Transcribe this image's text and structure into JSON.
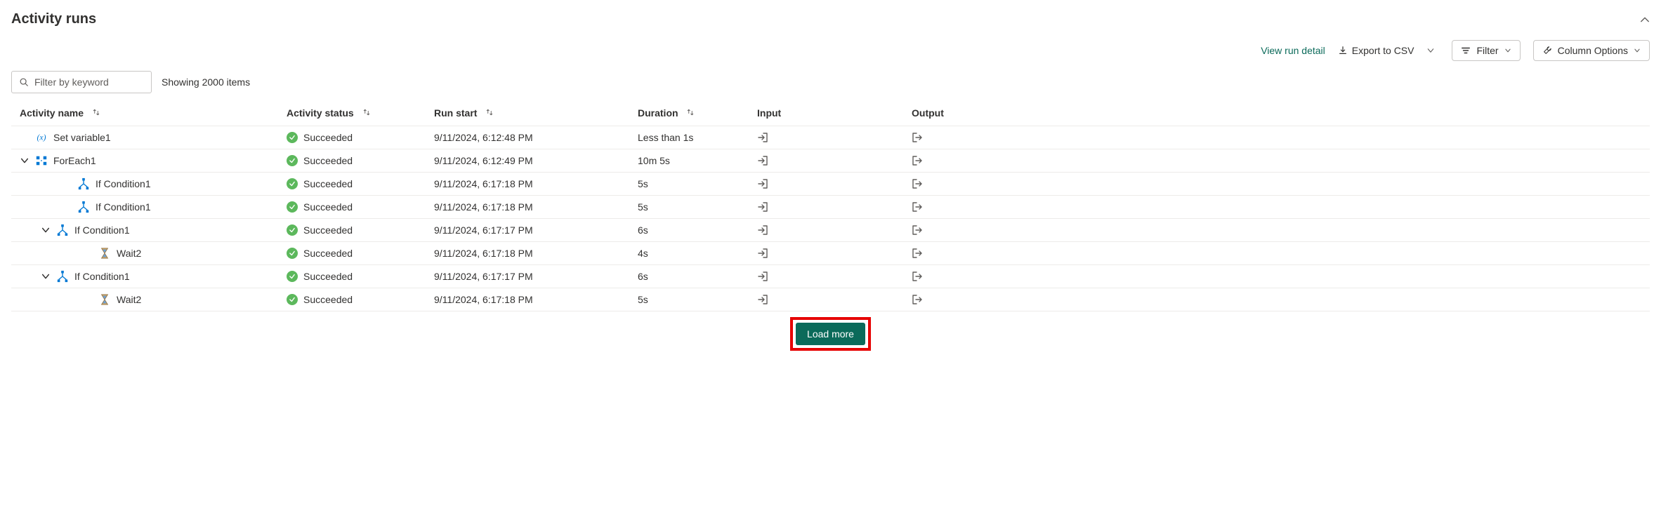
{
  "header": {
    "title": "Activity runs"
  },
  "toolbar": {
    "view_run_detail": "View run detail",
    "export_csv": "Export to CSV",
    "filter": "Filter",
    "column_options": "Column Options"
  },
  "filter": {
    "placeholder": "Filter by keyword",
    "showing": "Showing 2000 items"
  },
  "columns": {
    "name": "Activity name",
    "status": "Activity status",
    "start": "Run start",
    "duration": "Duration",
    "input": "Input",
    "output": "Output"
  },
  "status_labels": {
    "succeeded": "Succeeded"
  },
  "rows": [
    {
      "indent": 0,
      "expandable": false,
      "expanded": false,
      "icon": "variable",
      "name": "Set variable1",
      "status": "succeeded",
      "start": "9/11/2024, 6:12:48 PM",
      "duration": "Less than 1s"
    },
    {
      "indent": 0,
      "expandable": true,
      "expanded": true,
      "icon": "foreach",
      "name": "ForEach1",
      "status": "succeeded",
      "start": "9/11/2024, 6:12:49 PM",
      "duration": "10m 5s"
    },
    {
      "indent": 2,
      "expandable": false,
      "expanded": false,
      "icon": "condition",
      "name": "If Condition1",
      "status": "succeeded",
      "start": "9/11/2024, 6:17:18 PM",
      "duration": "5s"
    },
    {
      "indent": 2,
      "expandable": false,
      "expanded": false,
      "icon": "condition",
      "name": "If Condition1",
      "status": "succeeded",
      "start": "9/11/2024, 6:17:18 PM",
      "duration": "5s"
    },
    {
      "indent": 1,
      "expandable": true,
      "expanded": true,
      "icon": "condition",
      "name": "If Condition1",
      "status": "succeeded",
      "start": "9/11/2024, 6:17:17 PM",
      "duration": "6s"
    },
    {
      "indent": 3,
      "expandable": false,
      "expanded": false,
      "icon": "wait",
      "name": "Wait2",
      "status": "succeeded",
      "start": "9/11/2024, 6:17:18 PM",
      "duration": "4s"
    },
    {
      "indent": 1,
      "expandable": true,
      "expanded": true,
      "icon": "condition",
      "name": "If Condition1",
      "status": "succeeded",
      "start": "9/11/2024, 6:17:17 PM",
      "duration": "6s"
    },
    {
      "indent": 3,
      "expandable": false,
      "expanded": false,
      "icon": "wait",
      "name": "Wait2",
      "status": "succeeded",
      "start": "9/11/2024, 6:17:18 PM",
      "duration": "5s"
    }
  ],
  "footer": {
    "load_more": "Load more"
  }
}
